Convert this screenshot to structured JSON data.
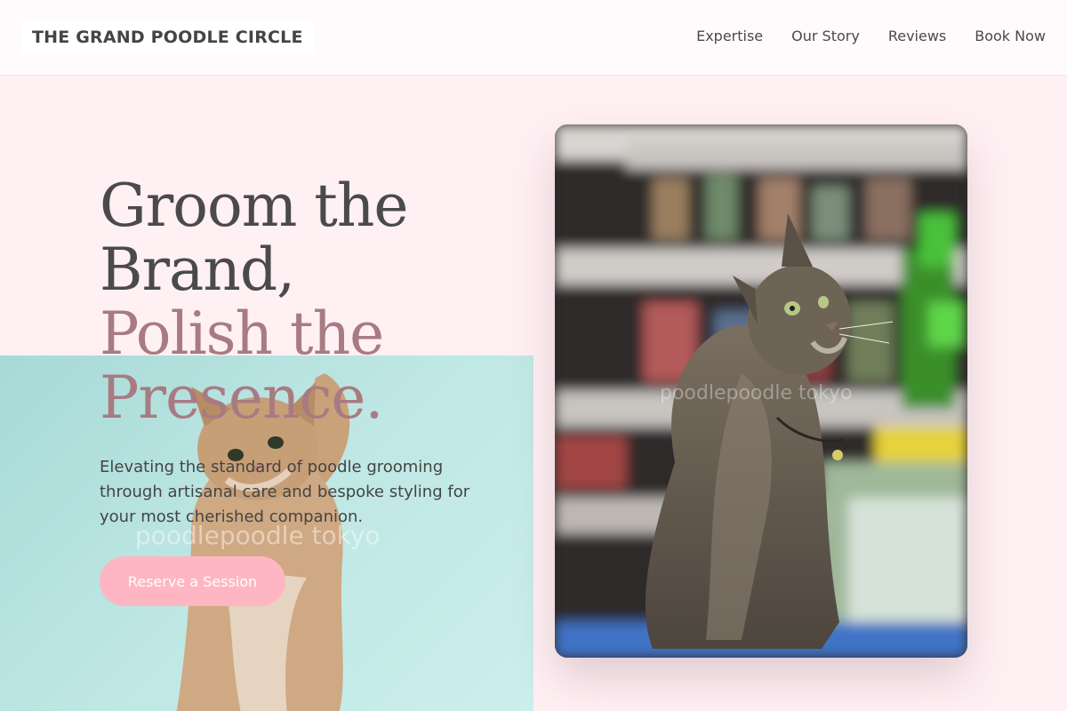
{
  "header": {
    "brand": "THE GRAND POODLE CIRCLE",
    "nav": [
      {
        "label": "Expertise"
      },
      {
        "label": "Our Story"
      },
      {
        "label": "Reviews"
      },
      {
        "label": "Book Now"
      }
    ]
  },
  "hero": {
    "title_line1": "Groom the",
    "title_line2": "Brand,",
    "accent_line1": "Polish the",
    "accent_line2": "Presence.",
    "description": "Elevating the standard of poodle grooming through artisanal care and bespoke styling for your most cherished companion.",
    "cta_label": "Reserve a Session"
  },
  "images": {
    "left_watermark": "poodlepoodle tokyo",
    "right_watermark": "poodlepoodle tokyo"
  },
  "colors": {
    "background": "#fff0f4",
    "accent_text": "#a87b82",
    "cta": "#ffb6c3",
    "teal": "#bfe7e4"
  }
}
